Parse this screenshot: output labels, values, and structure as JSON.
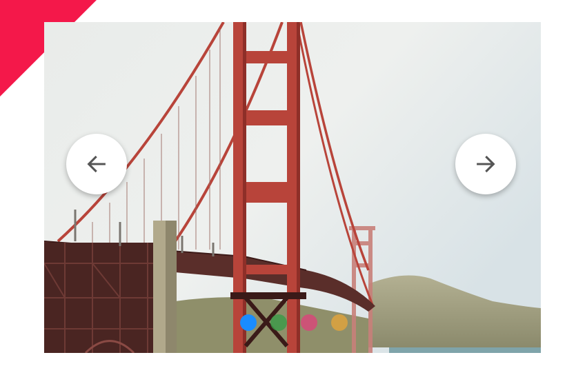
{
  "carousel": {
    "slide_subject": "golden-gate-bridge-photo",
    "prev_icon": "arrow-left-icon",
    "next_icon": "arrow-right-icon",
    "active_index": 0,
    "dots": [
      {
        "color": "#1a8cff",
        "active": true
      },
      {
        "color": "#3a9a48",
        "active": false
      },
      {
        "color": "#d9457a",
        "active": false
      },
      {
        "color": "#e0a43c",
        "active": false
      }
    ]
  },
  "colors": {
    "accent_ribbon": "#f4184a",
    "bridge_red": "#b8443a",
    "button_bg": "#ffffff",
    "arrow": "#555555"
  }
}
